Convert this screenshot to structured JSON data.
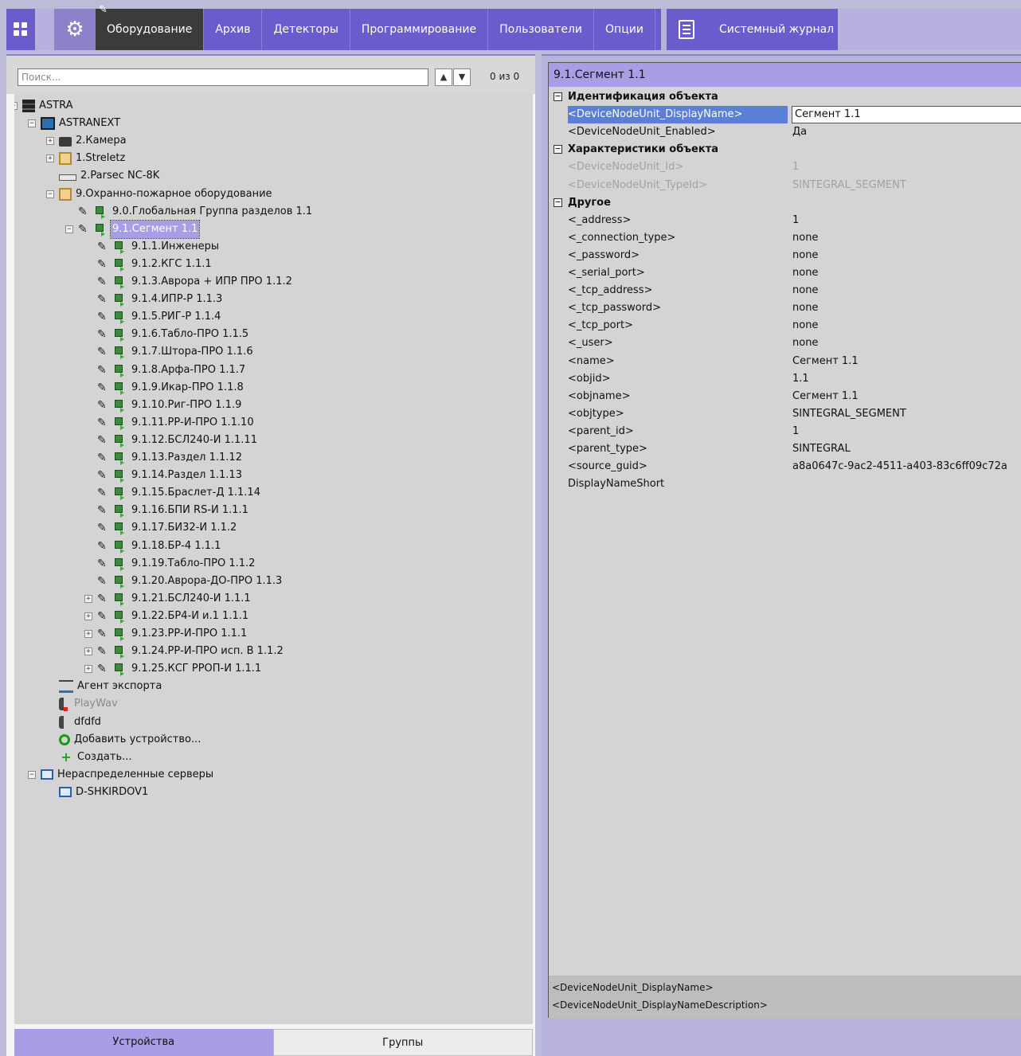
{
  "topbar": {
    "tabs": [
      {
        "label": "Оборудование",
        "active": true
      },
      {
        "label": "Архив",
        "active": false
      },
      {
        "label": "Детекторы",
        "active": false
      },
      {
        "label": "Программирование",
        "active": false
      },
      {
        "label": "Пользователи",
        "active": false
      },
      {
        "label": "Опции",
        "active": false
      }
    ],
    "journal": "Системный журнал"
  },
  "search": {
    "placeholder": "Поиск...",
    "count": "0 из 0",
    "prev": "^",
    "next": "v"
  },
  "tree": [
    {
      "label": "ASTRA",
      "icon": "server",
      "level": 0,
      "exp": "−"
    },
    {
      "label": "ASTRANEXT",
      "icon": "net",
      "level": 1,
      "exp": "−"
    },
    {
      "label": "2.Камера",
      "icon": "cam",
      "level": 2,
      "exp": "+"
    },
    {
      "label": "1.Streletz",
      "icon": "panel",
      "level": 2,
      "exp": "+"
    },
    {
      "label": "2.Parsec NC-8K",
      "icon": "parsec",
      "level": 2,
      "exp": ""
    },
    {
      "label": "9.Охранно-пожарное оборудование",
      "icon": "panel",
      "level": 2,
      "exp": "−"
    },
    {
      "label": "9.0.Глобальная Группа разделов 1.1",
      "icon": "chip",
      "level": 3,
      "exp": "",
      "pen": true
    },
    {
      "label": "9.1.Сегмент 1.1",
      "icon": "chip",
      "level": 3,
      "exp": "−",
      "pen": true,
      "selected": true
    },
    {
      "label": "9.1.1.Инженеры",
      "icon": "chip",
      "level": 4,
      "exp": "",
      "pen": true
    },
    {
      "label": "9.1.2.КГС 1.1.1",
      "icon": "chip",
      "level": 4,
      "exp": "",
      "pen": true
    },
    {
      "label": "9.1.3.Аврора + ИПР ПРО 1.1.2",
      "icon": "chip",
      "level": 4,
      "exp": "",
      "pen": true
    },
    {
      "label": "9.1.4.ИПР-Р 1.1.3",
      "icon": "chip",
      "level": 4,
      "exp": "",
      "pen": true
    },
    {
      "label": "9.1.5.РИГ-Р 1.1.4",
      "icon": "chip",
      "level": 4,
      "exp": "",
      "pen": true
    },
    {
      "label": "9.1.6.Табло-ПРО 1.1.5",
      "icon": "chip",
      "level": 4,
      "exp": "",
      "pen": true
    },
    {
      "label": "9.1.7.Штора-ПРО 1.1.6",
      "icon": "chip",
      "level": 4,
      "exp": "",
      "pen": true
    },
    {
      "label": "9.1.8.Арфа-ПРО 1.1.7",
      "icon": "chip",
      "level": 4,
      "exp": "",
      "pen": true
    },
    {
      "label": "9.1.9.Икар-ПРО 1.1.8",
      "icon": "chip",
      "level": 4,
      "exp": "",
      "pen": true
    },
    {
      "label": "9.1.10.Риг-ПРО 1.1.9",
      "icon": "chip",
      "level": 4,
      "exp": "",
      "pen": true
    },
    {
      "label": "9.1.11.РР-И-ПРО 1.1.10",
      "icon": "chip",
      "level": 4,
      "exp": "",
      "pen": true
    },
    {
      "label": "9.1.12.БСЛ240-И 1.1.11",
      "icon": "chip",
      "level": 4,
      "exp": "",
      "pen": true
    },
    {
      "label": "9.1.13.Раздел 1.1.12",
      "icon": "chip",
      "level": 4,
      "exp": "",
      "pen": true
    },
    {
      "label": "9.1.14.Раздел 1.1.13",
      "icon": "chip",
      "level": 4,
      "exp": "",
      "pen": true
    },
    {
      "label": "9.1.15.Браслет-Д 1.1.14",
      "icon": "chip",
      "level": 4,
      "exp": "",
      "pen": true
    },
    {
      "label": "9.1.16.БПИ RS-И 1.1.1",
      "icon": "chip",
      "level": 4,
      "exp": "",
      "pen": true
    },
    {
      "label": "9.1.17.БИ32-И 1.1.2",
      "icon": "chip",
      "level": 4,
      "exp": "",
      "pen": true
    },
    {
      "label": "9.1.18.БР-4 1.1.1",
      "icon": "chip",
      "level": 4,
      "exp": "",
      "pen": true
    },
    {
      "label": "9.1.19.Табло-ПРО 1.1.2",
      "icon": "chip",
      "level": 4,
      "exp": "",
      "pen": true
    },
    {
      "label": "9.1.20.Аврора-ДО-ПРО 1.1.3",
      "icon": "chip",
      "level": 4,
      "exp": "",
      "pen": true
    },
    {
      "label": "9.1.21.БСЛ240-И 1.1.1",
      "icon": "chip",
      "level": 4,
      "exp": "+",
      "pen": true
    },
    {
      "label": "9.1.22.БР4-И и.1 1.1.1",
      "icon": "chip",
      "level": 4,
      "exp": "+",
      "pen": true
    },
    {
      "label": "9.1.23.РР-И-ПРО 1.1.1",
      "icon": "chip",
      "level": 4,
      "exp": "+",
      "pen": true
    },
    {
      "label": "9.1.24.РР-И-ПРО исп. В 1.1.2",
      "icon": "chip",
      "level": 4,
      "exp": "+",
      "pen": true
    },
    {
      "label": "9.1.25.КСГ РРОП-И 1.1.1",
      "icon": "chip",
      "level": 4,
      "exp": "+",
      "pen": true
    },
    {
      "label": "Агент экспорта",
      "icon": "export",
      "level": 2,
      "exp": ""
    },
    {
      "label": "PlayWav",
      "icon": "speaker off",
      "level": 2,
      "exp": "",
      "disabled": true
    },
    {
      "label": "dfdfd",
      "icon": "speaker",
      "level": 2,
      "exp": ""
    },
    {
      "label": "Добавить устройство...",
      "icon": "search",
      "level": 2,
      "exp": ""
    },
    {
      "label": "Создать...",
      "icon": "create",
      "level": 2,
      "exp": ""
    },
    {
      "label": "Нераспределенные серверы",
      "icon": "monitor",
      "level": 1,
      "exp": "−"
    },
    {
      "label": "D-SHKIRDOV1",
      "icon": "monitor",
      "level": 2,
      "exp": ""
    }
  ],
  "panel_tabs": {
    "devices": "Устройства",
    "groups": "Группы"
  },
  "props": {
    "title": "9.1.Сегмент 1.1",
    "rows": [
      {
        "type": "cat",
        "key": "Идентификация объекта"
      },
      {
        "key": "<DeviceNodeUnit_DisplayName>",
        "value": "Сегмент 1.1",
        "selected": true
      },
      {
        "key": "<DeviceNodeUnit_Enabled>",
        "value": "Да"
      },
      {
        "type": "cat",
        "key": "Характеристики объекта"
      },
      {
        "key": "<DeviceNodeUnit_Id>",
        "value": "1",
        "disabled": true
      },
      {
        "key": "<DeviceNodeUnit_TypeId>",
        "value": "SINTEGRAL_SEGMENT",
        "disabled": true
      },
      {
        "type": "cat",
        "key": "Другое"
      },
      {
        "key": "<_address>",
        "value": "1"
      },
      {
        "key": "<_connection_type>",
        "value": "none"
      },
      {
        "key": "<_password>",
        "value": "none"
      },
      {
        "key": "<_serial_port>",
        "value": "none"
      },
      {
        "key": "<_tcp_address>",
        "value": "none"
      },
      {
        "key": "<_tcp_password>",
        "value": "none"
      },
      {
        "key": "<_tcp_port>",
        "value": "none"
      },
      {
        "key": "<_user>",
        "value": "none"
      },
      {
        "key": "<name>",
        "value": "Сегмент 1.1"
      },
      {
        "key": "<objid>",
        "value": "1.1"
      },
      {
        "key": "<objname>",
        "value": "Сегмент 1.1"
      },
      {
        "key": "<objtype>",
        "value": "SINTEGRAL_SEGMENT"
      },
      {
        "key": "<parent_id>",
        "value": "1"
      },
      {
        "key": "<parent_type>",
        "value": "SINTEGRAL"
      },
      {
        "key": "<source_guid>",
        "value": "a8a0647c-9ac2-4511-a403-83c6ff09c72a"
      },
      {
        "key": "DisplayNameShort",
        "value": ""
      }
    ],
    "desc_title": "<DeviceNodeUnit_DisplayName>",
    "desc_text": "<DeviceNodeUnit_DisplayNameDescription>"
  }
}
